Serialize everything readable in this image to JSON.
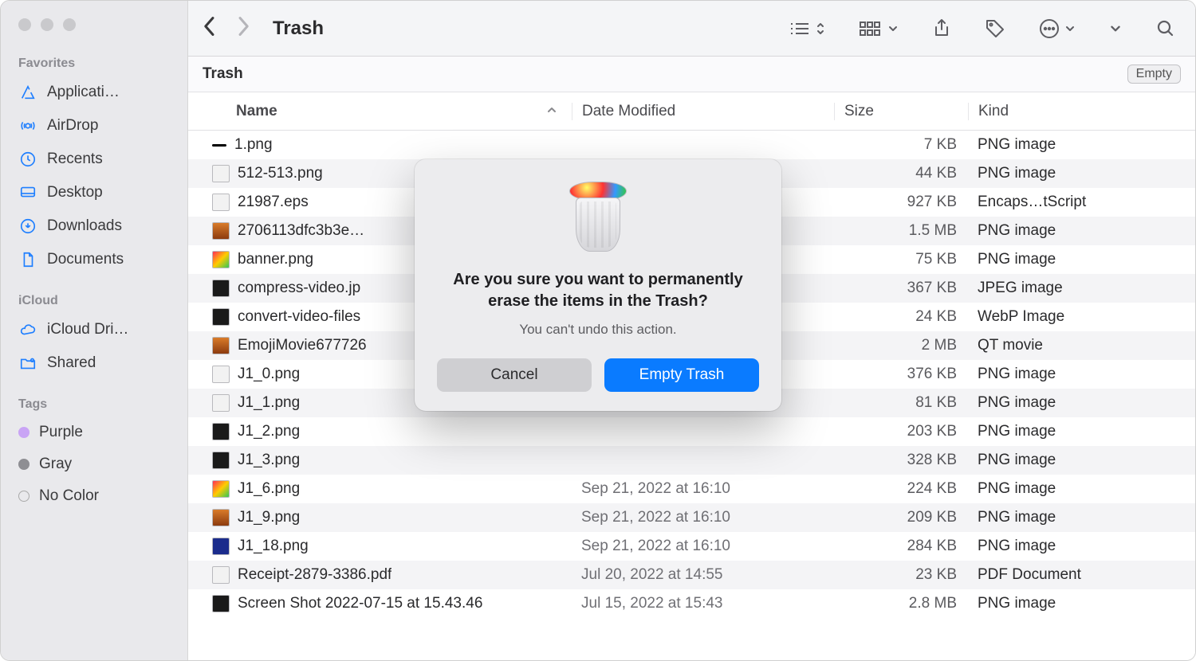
{
  "window": {
    "title": "Trash"
  },
  "sidebar": {
    "sections": [
      {
        "label": "Favorites",
        "items": [
          {
            "label": "Applicati…",
            "icon": "apps"
          },
          {
            "label": "AirDrop",
            "icon": "airdrop"
          },
          {
            "label": "Recents",
            "icon": "clock"
          },
          {
            "label": "Desktop",
            "icon": "desktop"
          },
          {
            "label": "Downloads",
            "icon": "download"
          },
          {
            "label": "Documents",
            "icon": "doc"
          }
        ]
      },
      {
        "label": "iCloud",
        "items": [
          {
            "label": "iCloud Dri…",
            "icon": "cloud"
          },
          {
            "label": "Shared",
            "icon": "shared"
          }
        ]
      },
      {
        "label": "Tags",
        "items": [
          {
            "label": "Purple",
            "icon": "tag-purple"
          },
          {
            "label": "Gray",
            "icon": "tag-gray"
          },
          {
            "label": "No Color",
            "icon": "tag-none"
          }
        ]
      }
    ]
  },
  "locationbar": {
    "title": "Trash",
    "empty_label": "Empty"
  },
  "columns": {
    "name": "Name",
    "date": "Date Modified",
    "size": "Size",
    "kind": "Kind"
  },
  "files": [
    {
      "name": "1.png",
      "date": "",
      "size": "7 KB",
      "kind": "PNG image",
      "icon": "dash"
    },
    {
      "name": "512-513.png",
      "date": "",
      "size": "44 KB",
      "kind": "PNG image",
      "icon": "light"
    },
    {
      "name": "21987.eps",
      "date": "",
      "size": "927 KB",
      "kind": "Encaps…tScript",
      "icon": "light"
    },
    {
      "name": "2706113dfc3b3e…",
      "date": "",
      "size": "1.5 MB",
      "kind": "PNG image",
      "icon": "img"
    },
    {
      "name": "banner.png",
      "date": "",
      "size": "75 KB",
      "kind": "PNG image",
      "icon": "colorful"
    },
    {
      "name": "compress-video.jp",
      "date": "",
      "size": "367 KB",
      "kind": "JPEG image",
      "icon": "dark"
    },
    {
      "name": "convert-video-files",
      "date": "",
      "size": "24 KB",
      "kind": "WebP Image",
      "icon": "dark"
    },
    {
      "name": "EmojiMovie677726",
      "date": "",
      "size": "2 MB",
      "kind": "QT movie",
      "icon": "img"
    },
    {
      "name": "J1_0.png",
      "date": "",
      "size": "376 KB",
      "kind": "PNG image",
      "icon": "light"
    },
    {
      "name": "J1_1.png",
      "date": "",
      "size": "81 KB",
      "kind": "PNG image",
      "icon": "light"
    },
    {
      "name": "J1_2.png",
      "date": "",
      "size": "203 KB",
      "kind": "PNG image",
      "icon": "dark"
    },
    {
      "name": "J1_3.png",
      "date": "",
      "size": "328 KB",
      "kind": "PNG image",
      "icon": "dark"
    },
    {
      "name": "J1_6.png",
      "date": "Sep 21, 2022 at 16:10",
      "size": "224 KB",
      "kind": "PNG image",
      "icon": "colorful"
    },
    {
      "name": "J1_9.png",
      "date": "Sep 21, 2022 at 16:10",
      "size": "209 KB",
      "kind": "PNG image",
      "icon": "img"
    },
    {
      "name": "J1_18.png",
      "date": "Sep 21, 2022 at 16:10",
      "size": "284 KB",
      "kind": "PNG image",
      "icon": "blue"
    },
    {
      "name": "Receipt-2879-3386.pdf",
      "date": "Jul 20, 2022 at 14:55",
      "size": "23 KB",
      "kind": "PDF Document",
      "icon": "light"
    },
    {
      "name": "Screen Shot 2022-07-15 at 15.43.46",
      "date": "Jul 15, 2022 at 15:43",
      "size": "2.8 MB",
      "kind": "PNG image",
      "icon": "dark"
    }
  ],
  "dialog": {
    "heading": "Are you sure you want to permanently erase the items in the Trash?",
    "body": "You can't undo this action.",
    "cancel": "Cancel",
    "confirm": "Empty Trash"
  }
}
